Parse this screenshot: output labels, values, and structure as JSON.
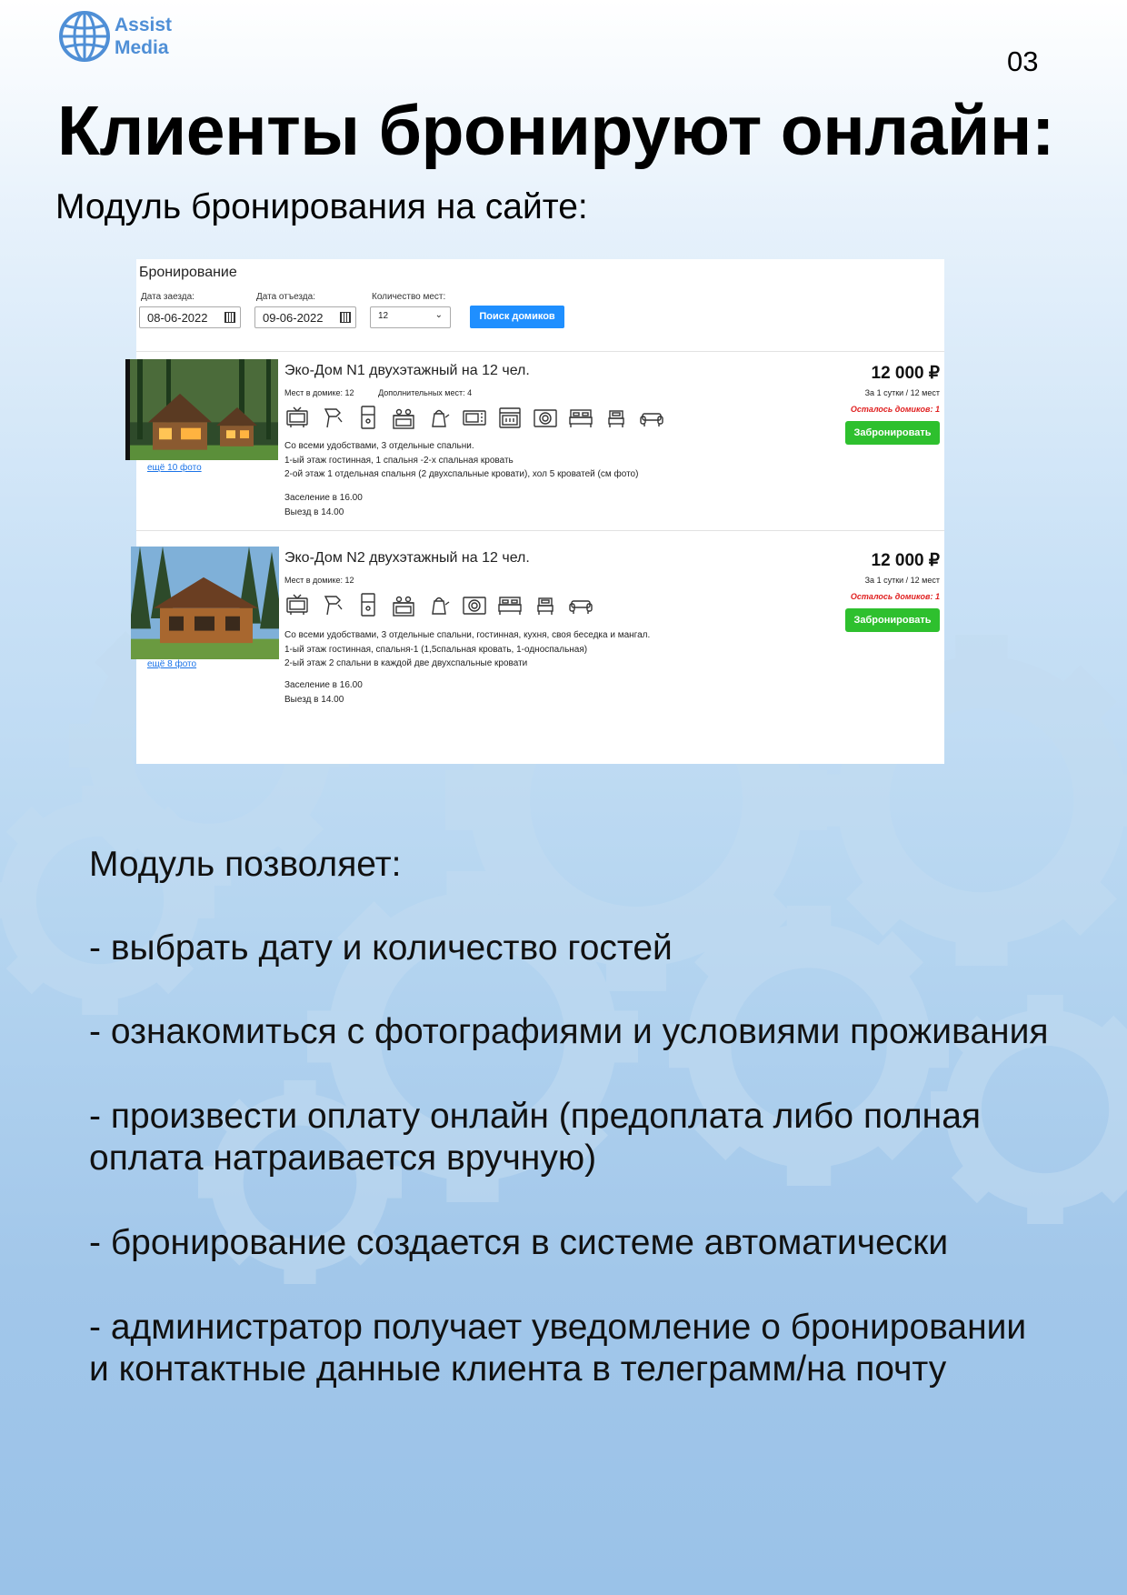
{
  "header": {
    "logo_line1": "Assist",
    "logo_line2": "Media",
    "page_number": "03",
    "title": "Клиенты бронируют онлайн:",
    "subtitle": "Модуль бронирования на сайте:"
  },
  "booking": {
    "heading": "Бронирование",
    "checkin_label": "Дата заезда:",
    "checkin_value": "08-06-2022",
    "checkout_label": "Дата отъезда:",
    "checkout_value": "09-06-2022",
    "guests_label": "Количество мест:",
    "guests_value": "12",
    "search_button": "Поиск домиков",
    "listings": [
      {
        "name": "Эко-Дом N1 двухэтажный на 12 чел.",
        "places": "Мест в домике: 12",
        "extra": "Дополнительных мест: 4",
        "desc1": "Со всеми удобствами, 3 отдельные спальни.",
        "desc2": "1-ый этаж гостинная, 1 спальня -2-х спальная кровать",
        "desc3": "2-ой этаж 1 отдельная спальня (2 двухспальные кровати), хол 5 кроватей (см фото)",
        "checkin_time": "Заселение в 16.00",
        "checkout_time": "Выезд в 14.00",
        "more_photos": "ещё 10 фото",
        "price": "12 000 ₽",
        "per_text": "За 1 сутки / 12 мест",
        "remaining": "Осталось домиков: 1",
        "book_button": "Забронировать",
        "amenities": [
          "tv-icon",
          "hairdryer-icon",
          "fridge-icon",
          "stove-icon",
          "kettle-icon",
          "microwave-icon",
          "oven-icon",
          "washer-icon",
          "double-bed-icon",
          "single-bed-icon",
          "sofa-icon"
        ]
      },
      {
        "name": "Эко-Дом N2 двухэтажный на 12 чел.",
        "places": "Мест в домике: 12",
        "extra": "",
        "desc1": "Со всеми удобствами, 3 отдельные спальни, гостинная, кухня, своя беседка и мангал.",
        "desc2": "1-ый этаж гостинная, спальня-1 (1,5спальная кровать, 1-односпальная)",
        "desc3": "2-ый этаж 2 спальни в каждой две двухспальные кровати",
        "checkin_time": "Заселение в 16.00",
        "checkout_time": "Выезд в 14.00",
        "more_photos": "ещё 8 фото",
        "price": "12 000 ₽",
        "per_text": "За 1 сутки / 12 мест",
        "remaining": "Осталось домиков: 1",
        "book_button": "Забронировать",
        "amenities": [
          "tv-icon",
          "hairdryer-icon",
          "fridge-icon",
          "stove-icon",
          "kettle-icon",
          "washer-icon",
          "double-bed-icon",
          "single-bed-icon",
          "sofa-icon"
        ]
      }
    ]
  },
  "features": {
    "intro": "Модуль позволяет:",
    "item1": "- выбрать дату и количество гостей",
    "item2": "- ознакомиться с фотографиями и условиями проживания",
    "item3a": "- произвести оплату онлайн (предоплата либо полная",
    "item3b": "оплата натраивается вручную)",
    "item4": "- бронирование создается в системе автоматически",
    "item5a": "- администратор получает уведомление о бронировании",
    "item5b": "и контактные данные клиента в телеграмм/на почту"
  },
  "colors": {
    "brand": "#4f8fd6",
    "search_button": "#1f8fff",
    "book_button": "#2ec02e",
    "remaining_text": "#e02020"
  }
}
